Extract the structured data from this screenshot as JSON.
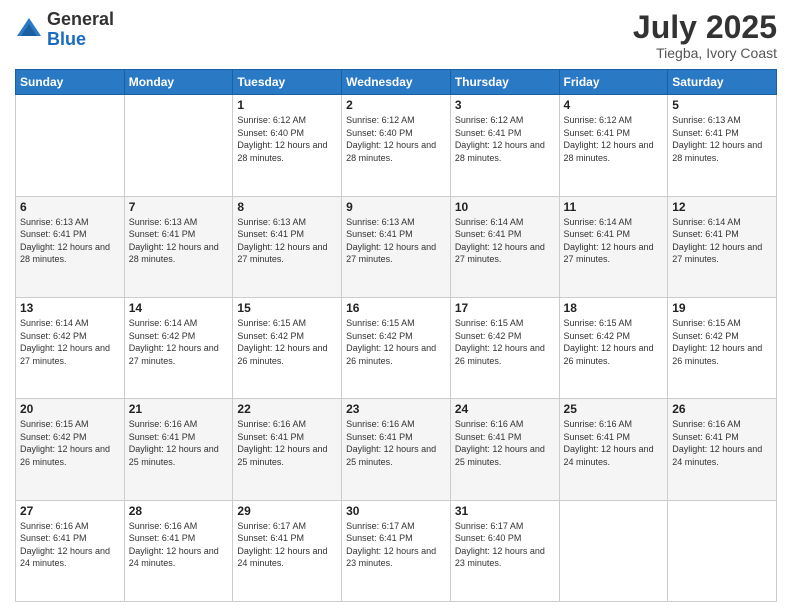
{
  "header": {
    "logo_general": "General",
    "logo_blue": "Blue",
    "month_title": "July 2025",
    "location": "Tiegba, Ivory Coast"
  },
  "days_of_week": [
    "Sunday",
    "Monday",
    "Tuesday",
    "Wednesday",
    "Thursday",
    "Friday",
    "Saturday"
  ],
  "weeks": [
    [
      {
        "day": "",
        "info": ""
      },
      {
        "day": "",
        "info": ""
      },
      {
        "day": "1",
        "info": "Sunrise: 6:12 AM\nSunset: 6:40 PM\nDaylight: 12 hours and 28 minutes."
      },
      {
        "day": "2",
        "info": "Sunrise: 6:12 AM\nSunset: 6:40 PM\nDaylight: 12 hours and 28 minutes."
      },
      {
        "day": "3",
        "info": "Sunrise: 6:12 AM\nSunset: 6:41 PM\nDaylight: 12 hours and 28 minutes."
      },
      {
        "day": "4",
        "info": "Sunrise: 6:12 AM\nSunset: 6:41 PM\nDaylight: 12 hours and 28 minutes."
      },
      {
        "day": "5",
        "info": "Sunrise: 6:13 AM\nSunset: 6:41 PM\nDaylight: 12 hours and 28 minutes."
      }
    ],
    [
      {
        "day": "6",
        "info": "Sunrise: 6:13 AM\nSunset: 6:41 PM\nDaylight: 12 hours and 28 minutes."
      },
      {
        "day": "7",
        "info": "Sunrise: 6:13 AM\nSunset: 6:41 PM\nDaylight: 12 hours and 28 minutes."
      },
      {
        "day": "8",
        "info": "Sunrise: 6:13 AM\nSunset: 6:41 PM\nDaylight: 12 hours and 27 minutes."
      },
      {
        "day": "9",
        "info": "Sunrise: 6:13 AM\nSunset: 6:41 PM\nDaylight: 12 hours and 27 minutes."
      },
      {
        "day": "10",
        "info": "Sunrise: 6:14 AM\nSunset: 6:41 PM\nDaylight: 12 hours and 27 minutes."
      },
      {
        "day": "11",
        "info": "Sunrise: 6:14 AM\nSunset: 6:41 PM\nDaylight: 12 hours and 27 minutes."
      },
      {
        "day": "12",
        "info": "Sunrise: 6:14 AM\nSunset: 6:41 PM\nDaylight: 12 hours and 27 minutes."
      }
    ],
    [
      {
        "day": "13",
        "info": "Sunrise: 6:14 AM\nSunset: 6:42 PM\nDaylight: 12 hours and 27 minutes."
      },
      {
        "day": "14",
        "info": "Sunrise: 6:14 AM\nSunset: 6:42 PM\nDaylight: 12 hours and 27 minutes."
      },
      {
        "day": "15",
        "info": "Sunrise: 6:15 AM\nSunset: 6:42 PM\nDaylight: 12 hours and 26 minutes."
      },
      {
        "day": "16",
        "info": "Sunrise: 6:15 AM\nSunset: 6:42 PM\nDaylight: 12 hours and 26 minutes."
      },
      {
        "day": "17",
        "info": "Sunrise: 6:15 AM\nSunset: 6:42 PM\nDaylight: 12 hours and 26 minutes."
      },
      {
        "day": "18",
        "info": "Sunrise: 6:15 AM\nSunset: 6:42 PM\nDaylight: 12 hours and 26 minutes."
      },
      {
        "day": "19",
        "info": "Sunrise: 6:15 AM\nSunset: 6:42 PM\nDaylight: 12 hours and 26 minutes."
      }
    ],
    [
      {
        "day": "20",
        "info": "Sunrise: 6:15 AM\nSunset: 6:42 PM\nDaylight: 12 hours and 26 minutes."
      },
      {
        "day": "21",
        "info": "Sunrise: 6:16 AM\nSunset: 6:41 PM\nDaylight: 12 hours and 25 minutes."
      },
      {
        "day": "22",
        "info": "Sunrise: 6:16 AM\nSunset: 6:41 PM\nDaylight: 12 hours and 25 minutes."
      },
      {
        "day": "23",
        "info": "Sunrise: 6:16 AM\nSunset: 6:41 PM\nDaylight: 12 hours and 25 minutes."
      },
      {
        "day": "24",
        "info": "Sunrise: 6:16 AM\nSunset: 6:41 PM\nDaylight: 12 hours and 25 minutes."
      },
      {
        "day": "25",
        "info": "Sunrise: 6:16 AM\nSunset: 6:41 PM\nDaylight: 12 hours and 24 minutes."
      },
      {
        "day": "26",
        "info": "Sunrise: 6:16 AM\nSunset: 6:41 PM\nDaylight: 12 hours and 24 minutes."
      }
    ],
    [
      {
        "day": "27",
        "info": "Sunrise: 6:16 AM\nSunset: 6:41 PM\nDaylight: 12 hours and 24 minutes."
      },
      {
        "day": "28",
        "info": "Sunrise: 6:16 AM\nSunset: 6:41 PM\nDaylight: 12 hours and 24 minutes."
      },
      {
        "day": "29",
        "info": "Sunrise: 6:17 AM\nSunset: 6:41 PM\nDaylight: 12 hours and 24 minutes."
      },
      {
        "day": "30",
        "info": "Sunrise: 6:17 AM\nSunset: 6:41 PM\nDaylight: 12 hours and 23 minutes."
      },
      {
        "day": "31",
        "info": "Sunrise: 6:17 AM\nSunset: 6:40 PM\nDaylight: 12 hours and 23 minutes."
      },
      {
        "day": "",
        "info": ""
      },
      {
        "day": "",
        "info": ""
      }
    ]
  ]
}
